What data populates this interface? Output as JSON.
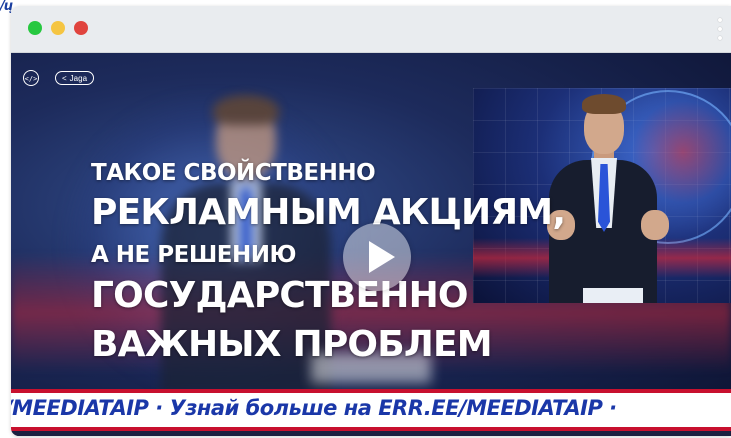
{
  "corner_logo": {
    "text": "/ų"
  },
  "window": {
    "controls": [
      "close",
      "minimize",
      "maximize"
    ],
    "menu_icon": "kebab-menu-icon"
  },
  "video": {
    "embed_label": "</>",
    "share_label": "Jaga",
    "share_icon": "share-icon",
    "play_icon": "play-icon",
    "overlay_lines": [
      "ТАКОЕ СВОЙСТВЕННО",
      "РЕКЛАМНЫМ АКЦИЯМ,",
      "А НЕ РЕШЕНИЮ",
      "ГОСУДАРСТВЕННО",
      "ВАЖНЫХ ПРОБЛЕМ"
    ],
    "ticker": "/MEEDIATAIP  ·  Узнай больше на ERR.EE/MEEDIATAIP  ·"
  },
  "colors": {
    "close": "#e0443e",
    "minimize": "#f5c542",
    "maximize": "#27c840",
    "ticker_text": "#1a37a8",
    "ticker_border": "#c8102e"
  }
}
